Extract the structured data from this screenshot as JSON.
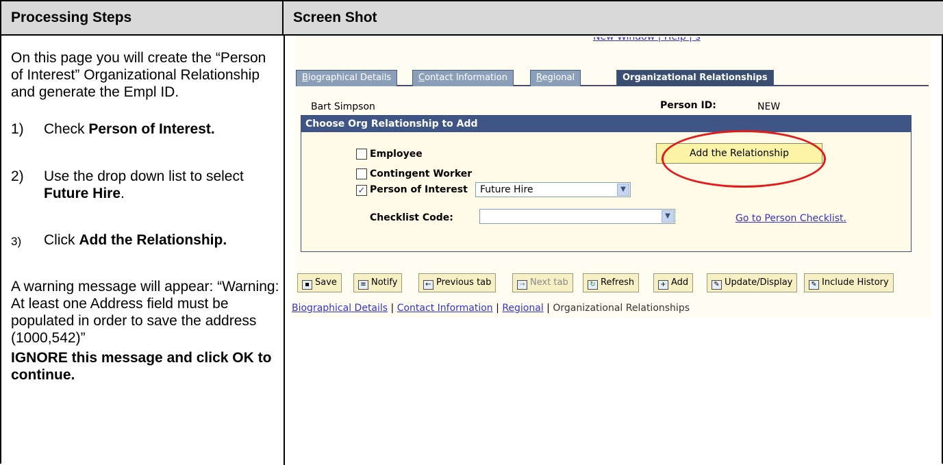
{
  "headers": {
    "left": "Processing Steps",
    "right": "Screen Shot"
  },
  "intro": "On this page you will create the “Person of Interest” Organizational Relationship and generate the Empl ID.",
  "steps": [
    {
      "num": "1)",
      "text_plain": "Check ",
      "text_bold": "Person of Interest."
    },
    {
      "num": "2)",
      "text_plain": "Use the drop down list to select ",
      "text_bold": "Future Hire",
      "text_tail": "."
    },
    {
      "num": "3)",
      "text_plain": "Click ",
      "text_bold": "Add the Relationship."
    }
  ],
  "warning": "A warning message will appear: “Warning: At least one Address field must be populated in order to save the address (1000,542)”",
  "ignore": "IGNORE this message and click OK to continue.",
  "screenshot": {
    "toplinks": "New Window | Help | s",
    "tabs": [
      {
        "label": "Biographical Details",
        "underline": "B",
        "rest": "iographical Details"
      },
      {
        "label": "Contact Information",
        "underline": "C",
        "rest": "ontact Information"
      },
      {
        "label": "Regional",
        "underline": "R",
        "rest": "egional"
      },
      {
        "label": "Organizational Relationships"
      }
    ],
    "person_name": "Bart Simpson",
    "person_id_label": "Person ID:",
    "person_id_value": "NEW",
    "group_title": "Choose Org Relationship to Add",
    "employee_label": "Employee",
    "contingent_label": "Contingent Worker",
    "poi_label": "Person of Interest",
    "poi_checked": true,
    "poi_select_value": "Future Hire",
    "checklist_label": "Checklist Code:",
    "checklist_value": "",
    "add_button": "Add the Relationship",
    "go_link": "Go to Person Checklist.",
    "toolbar": {
      "save": "Save",
      "notify": "Notify",
      "previous": "Previous tab",
      "next": "Next tab",
      "refresh": "Refresh",
      "add": "Add",
      "update": "Update/Display",
      "history": "Include History"
    },
    "bottom_links": [
      "Biographical Details",
      "Contact Information",
      "Regional",
      "Organizational Relationships"
    ],
    "bottom_sep": " | "
  },
  "colors": {
    "tab_active": "#3a4e72",
    "tab_inactive": "#8c9fb9",
    "highlight_ellipse": "#e41a1a",
    "button_bg": "#fbf3a6",
    "header_bg": "#d9d9d9"
  }
}
